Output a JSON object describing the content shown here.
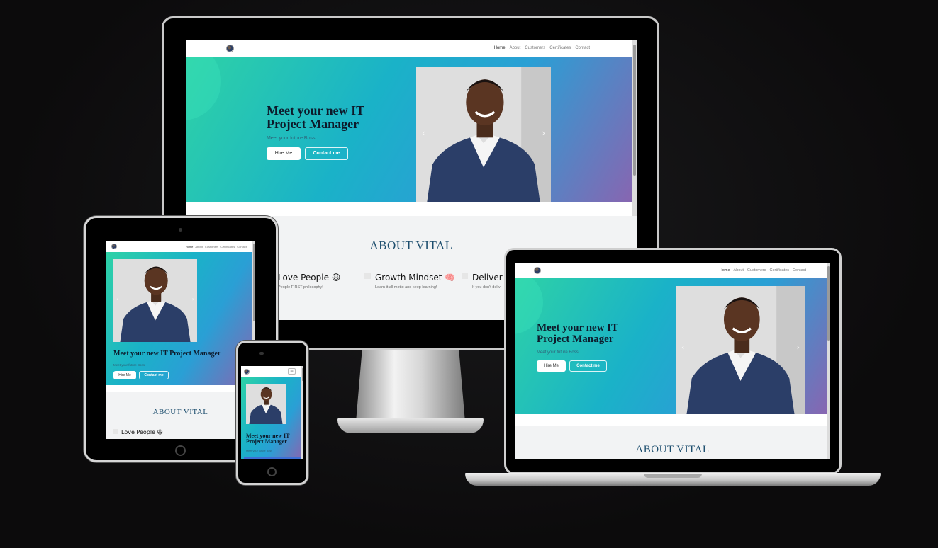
{
  "site": {
    "nav_links": [
      "Home",
      "About",
      "Customers",
      "Certificates",
      "Contact"
    ],
    "hero_title_line1": "Meet your new IT",
    "hero_title_line2": "Project Manager",
    "hero_title_full": "Meet your new IT Project Manager",
    "hero_subtitle": "Meet your future Boss",
    "hire_button": "Hire Me",
    "contact_button": "Contact me",
    "about_title": "ABOUT VITAL",
    "cards": [
      {
        "title": "Love People 😃",
        "text": "People FIRST philosophy!"
      },
      {
        "title": "Growth Mindset 🧠",
        "text": "Learn it all motto and keep learning!"
      },
      {
        "title": "Deliver :",
        "text": "If you don't deliv"
      }
    ],
    "menu_icon": "hamburger-menu-icon",
    "carousel_prev_icon": "chevron-left-icon",
    "carousel_next_icon": "chevron-right-icon"
  },
  "colors": {
    "background": "#0c0b0c",
    "hero_start": "#2ed2a6",
    "hero_mid": "#2a9fd5",
    "hero_end": "#8a64b0",
    "about_title": "#1d4e6e",
    "heading": "#0d1a2b"
  }
}
